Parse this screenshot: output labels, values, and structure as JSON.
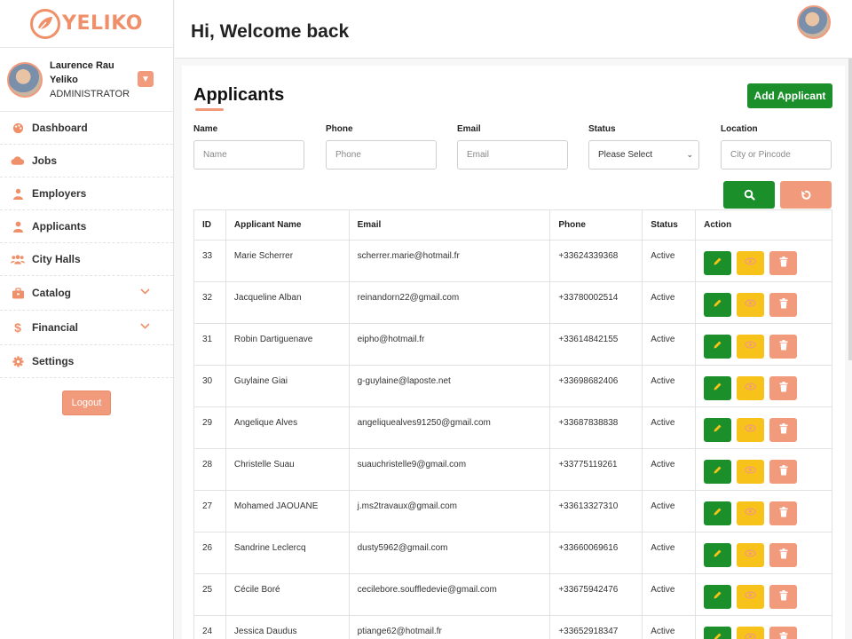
{
  "brand": {
    "name": "YELIKO",
    "accent": "#f29b7c",
    "primary": "#1a8f2a"
  },
  "profile": {
    "name": "Laurence Rau Yeliko",
    "role": "ADMINISTRATOR"
  },
  "nav": [
    {
      "label": "Dashboard",
      "icon": "palette-icon"
    },
    {
      "label": "Jobs",
      "icon": "cloud-icon"
    },
    {
      "label": "Employers",
      "icon": "employer-icon"
    },
    {
      "label": "Applicants",
      "icon": "user-icon"
    },
    {
      "label": "City Halls",
      "icon": "users-icon"
    },
    {
      "label": "Catalog",
      "icon": "briefcase-icon"
    },
    {
      "label": "Financial",
      "icon": "dollar-icon"
    },
    {
      "label": "Settings",
      "icon": "gear-icon"
    }
  ],
  "logout_label": "Logout",
  "header": {
    "welcome": "Hi, Welcome back"
  },
  "page": {
    "title": "Applicants",
    "add_label": "Add Applicant"
  },
  "filters": {
    "name": {
      "label": "Name",
      "placeholder": "Name"
    },
    "phone": {
      "label": "Phone",
      "placeholder": "Phone"
    },
    "email": {
      "label": "Email",
      "placeholder": "Email"
    },
    "status": {
      "label": "Status",
      "value": "Please Select"
    },
    "location": {
      "label": "Location",
      "placeholder": "City or Pincode"
    }
  },
  "table": {
    "headers": [
      "ID",
      "Applicant Name",
      "Email",
      "Phone",
      "Status",
      "Action"
    ],
    "rows": [
      {
        "id": "33",
        "name": "Marie Scherrer",
        "email": "scherrer.marie@hotmail.fr",
        "phone": "+33624339368",
        "status": "Active"
      },
      {
        "id": "32",
        "name": "Jacqueline Alban",
        "email": "reinandorn22@gmail.com",
        "phone": "+33780002514",
        "status": "Active"
      },
      {
        "id": "31",
        "name": "Robin Dartiguenave",
        "email": "eipho@hotmail.fr",
        "phone": "+33614842155",
        "status": "Active"
      },
      {
        "id": "30",
        "name": "Guylaine Giai",
        "email": "g-guylaine@laposte.net",
        "phone": "+33698682406",
        "status": "Active"
      },
      {
        "id": "29",
        "name": "Angelique Alves",
        "email": "angeliquealves91250@gmail.com",
        "phone": "+33687838838",
        "status": "Active"
      },
      {
        "id": "28",
        "name": "Christelle Suau",
        "email": "suauchristelle9@gmail.com",
        "phone": "+33775119261",
        "status": "Active"
      },
      {
        "id": "27",
        "name": "Mohamed JAOUANE",
        "email": "j.ms2travaux@gmail.com",
        "phone": "+33613327310",
        "status": "Active"
      },
      {
        "id": "26",
        "name": "Sandrine Leclercq",
        "email": "dusty5962@gmail.com",
        "phone": "+33660069616",
        "status": "Active"
      },
      {
        "id": "25",
        "name": "Cécile Boré",
        "email": "cecilebore.souffledevie@gmail.com",
        "phone": "+33675942476",
        "status": "Active"
      },
      {
        "id": "24",
        "name": "Jessica Daudus",
        "email": "ptiange62@hotmail.fr",
        "phone": "+33652918347",
        "status": "Active"
      }
    ]
  }
}
